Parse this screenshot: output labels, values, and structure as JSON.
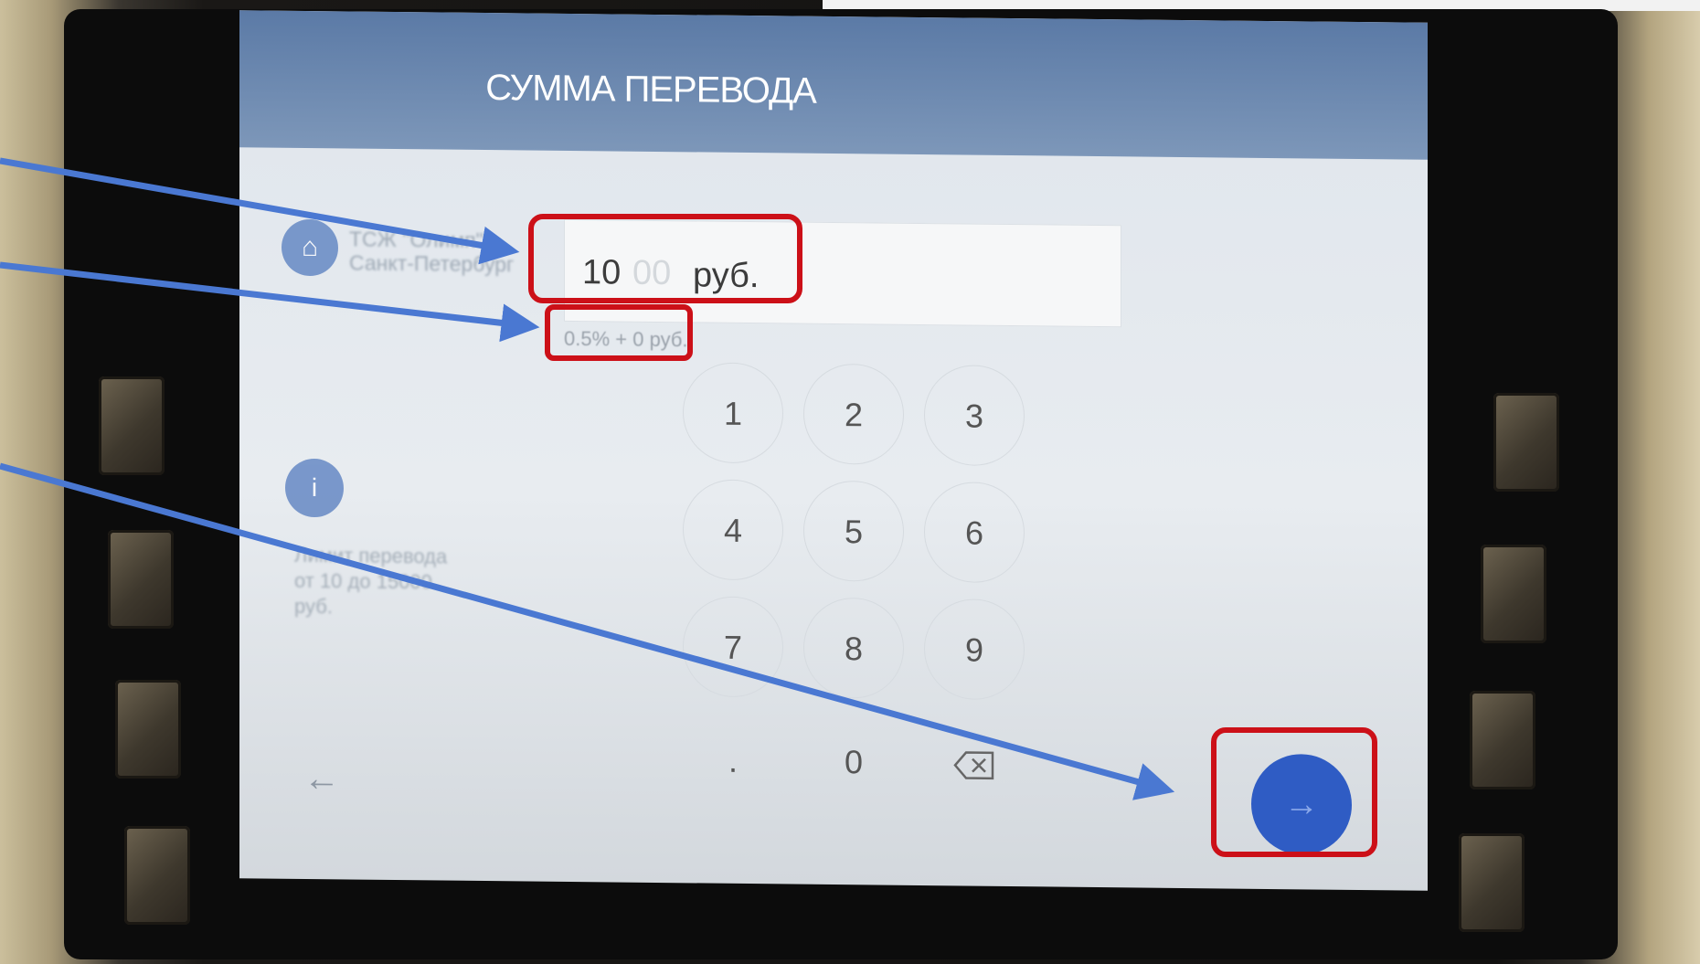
{
  "screen": {
    "title": "СУММА ПЕРЕВОДА",
    "recipient": {
      "name_line1": "ТСЖ \"Олимп\"",
      "name_line2": "Санкт-Петербург"
    },
    "amount": {
      "integer_part": "10",
      "decimal_part": "00",
      "currency": "руб."
    },
    "commission": "0.5% + 0 руб.",
    "limit": {
      "line1": "Лимит перевода",
      "line2": "от 10 до 15000",
      "line3": "руб."
    },
    "keypad": {
      "keys": [
        "1",
        "2",
        "3",
        "4",
        "5",
        "6",
        "7",
        "8",
        "9",
        ".",
        "0"
      ],
      "backspace_icon": "backspace-icon"
    },
    "back_icon": "arrow-left-icon",
    "next_icon": "arrow-right-icon"
  },
  "colors": {
    "header": "#5b7aa6",
    "accent": "#2f5cc4",
    "annotation_box": "#cc1018",
    "annotation_arrow": "#4a78d2"
  }
}
